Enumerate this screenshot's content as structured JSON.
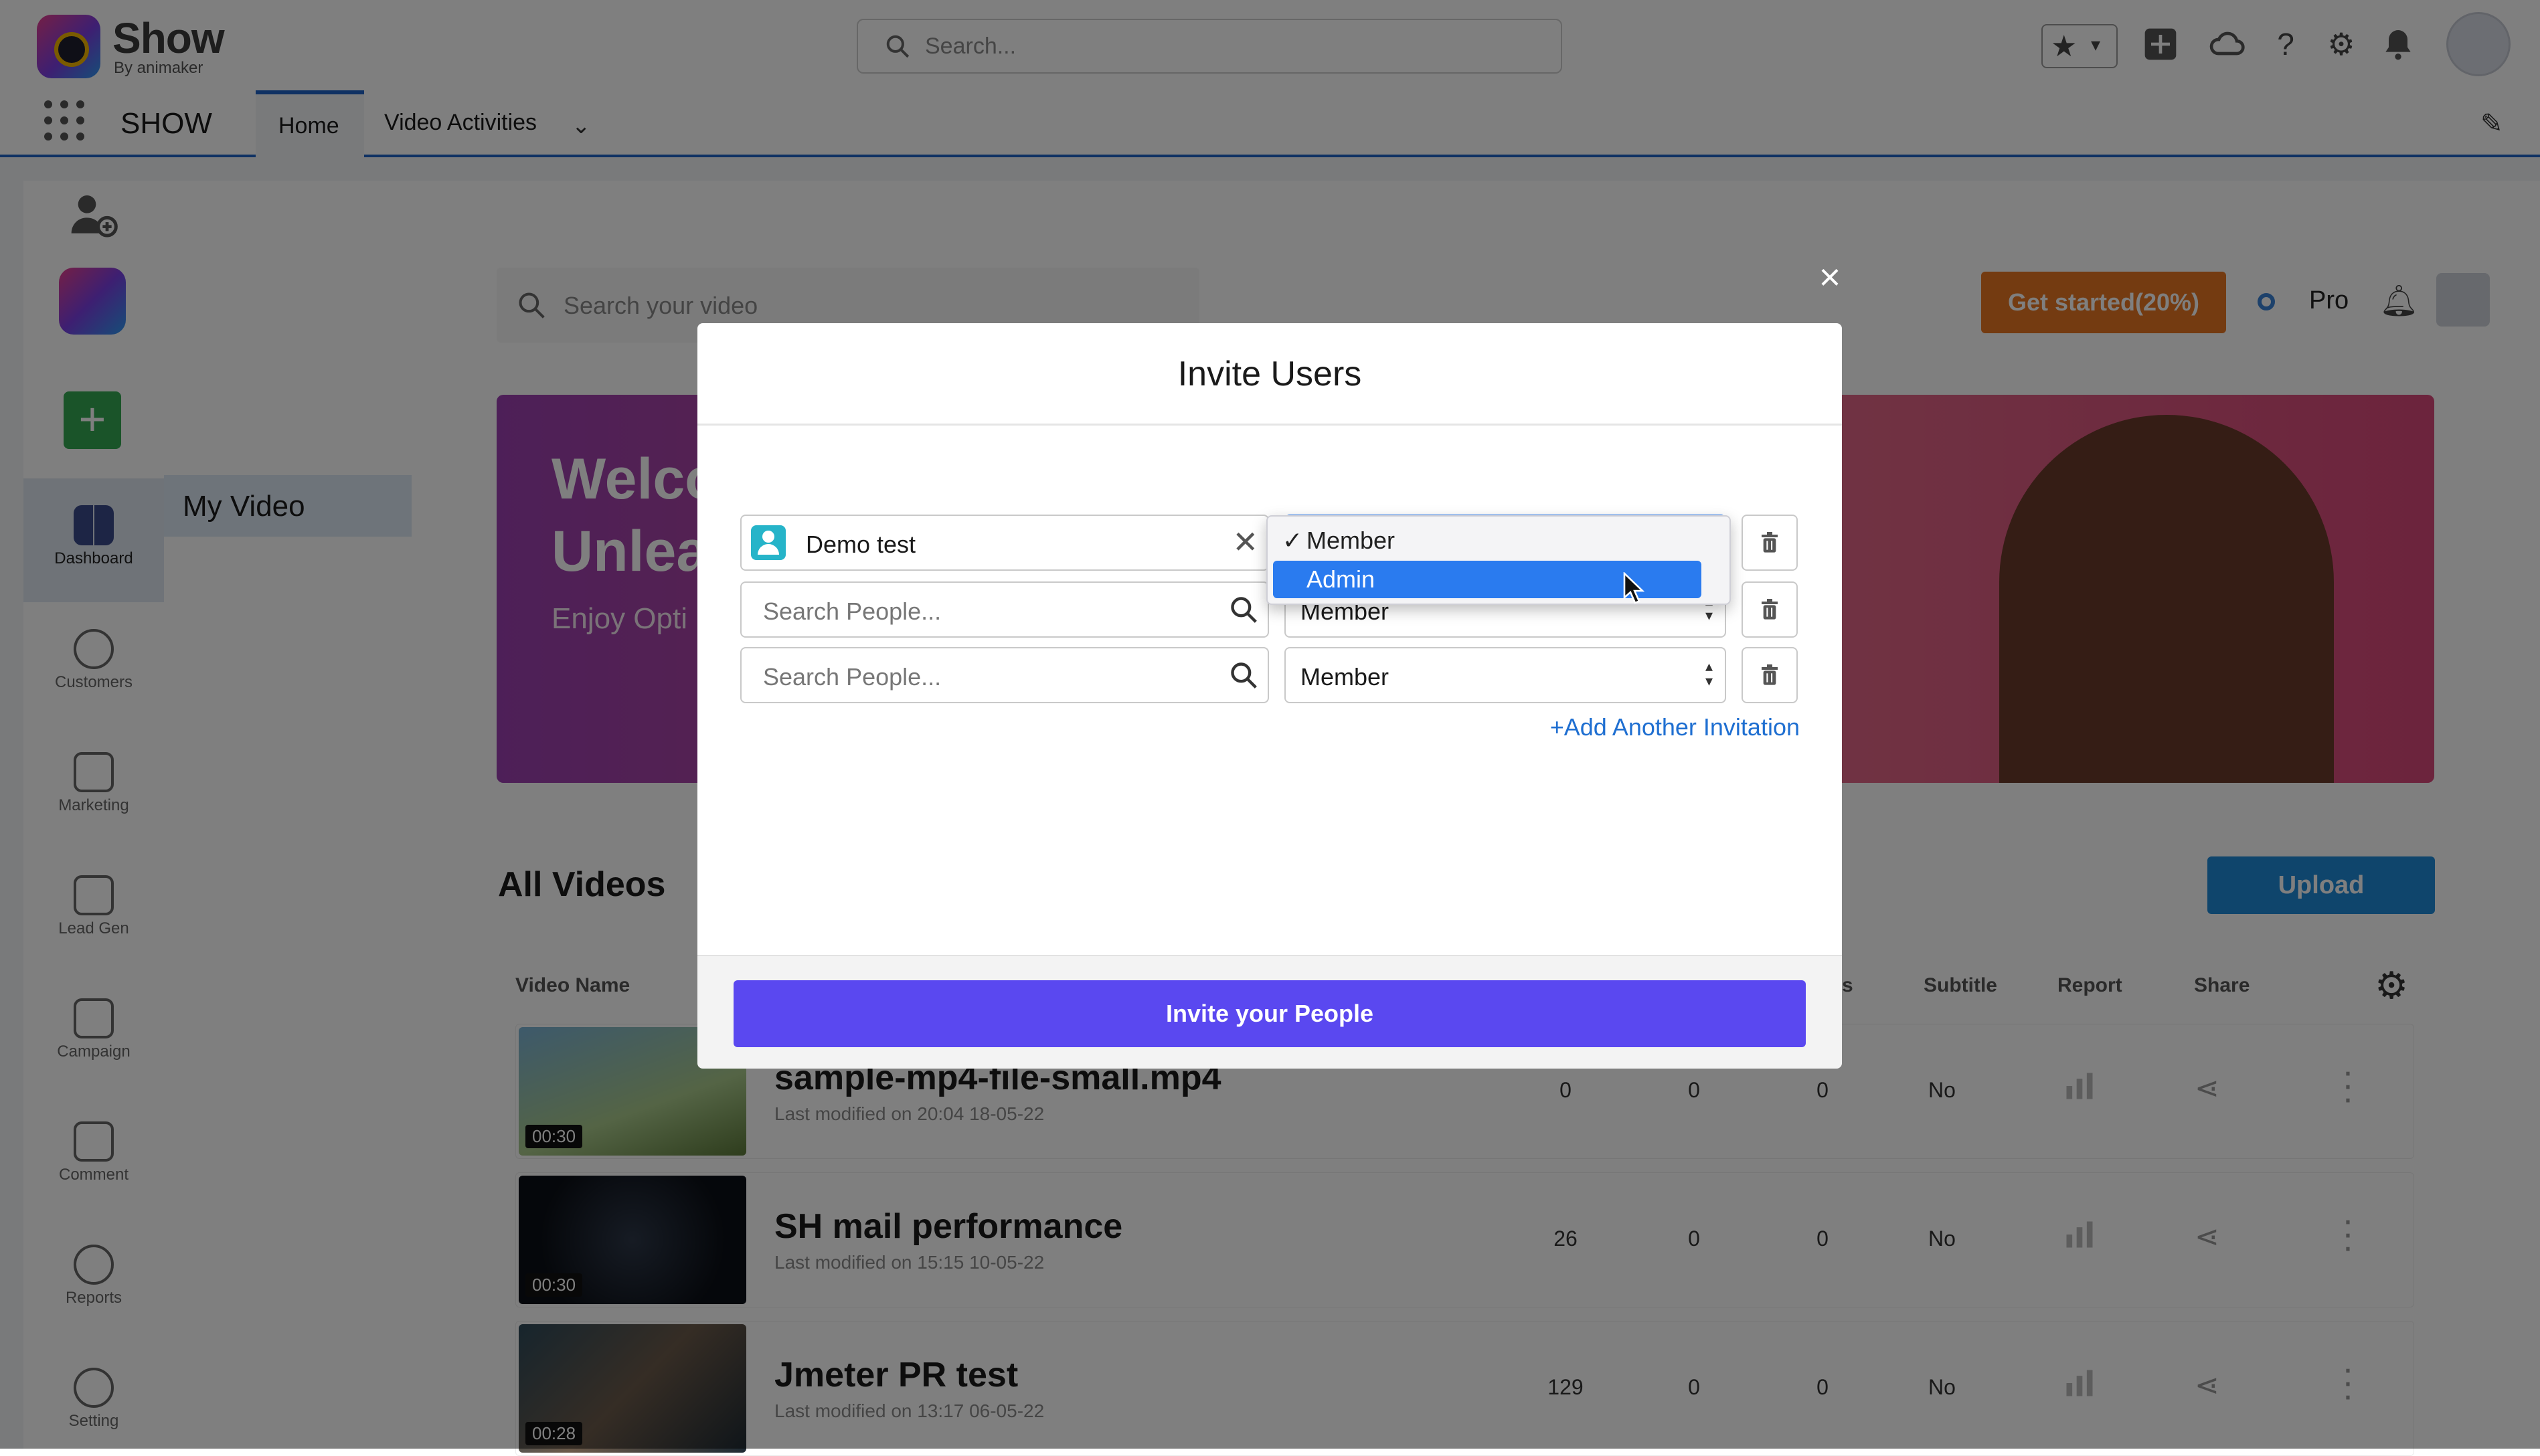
{
  "header": {
    "logo_text": "Show",
    "logo_sub": "By animaker",
    "search_placeholder": "Search...",
    "icons": [
      "star-icon",
      "chevron-down-icon",
      "plus-icon",
      "cloud-icon",
      "help-icon",
      "gear-icon",
      "bell-icon",
      "avatar"
    ]
  },
  "nav": {
    "app_name": "SHOW",
    "tabs": [
      {
        "label": "Home",
        "active": true
      },
      {
        "label": "Video Activities",
        "active": false
      }
    ]
  },
  "left_rail": {
    "items": [
      {
        "label": "Dashboard",
        "icon": "dashboard-icon",
        "active": true
      },
      {
        "label": "Customers",
        "icon": "person-icon"
      },
      {
        "label": "Marketing",
        "icon": "monitor-icon"
      },
      {
        "label": "Lead Gen",
        "icon": "lead-icon"
      },
      {
        "label": "Campaign",
        "icon": "ad-icon"
      },
      {
        "label": "Comment",
        "icon": "comment-icon"
      },
      {
        "label": "Reports",
        "icon": "reports-icon"
      },
      {
        "label": "Setting",
        "icon": "gear-icon"
      }
    ]
  },
  "side_panel": {
    "active_item": "My Video"
  },
  "content": {
    "search_placeholder": "Search your video",
    "get_started": "Get started(20%)",
    "plan": "Pro",
    "banner": {
      "line1": "Welco",
      "line2": "Unleas",
      "line3": "Enjoy Opti"
    },
    "section_title": "All Videos",
    "upload_label": "Upload",
    "columns": [
      "Video Name",
      "s",
      "Subtitle",
      "Report",
      "Share"
    ],
    "videos": [
      {
        "name": "sample-mp4-file-small.mp4",
        "modified": "Last modified on 20:04 18-05-22",
        "duration": "00:30",
        "c1": "0",
        "c2": "0",
        "c3": "0",
        "subtitle": "No"
      },
      {
        "name": "SH mail performance",
        "modified": "Last modified on 15:15 10-05-22",
        "duration": "00:30",
        "c1": "26",
        "c2": "0",
        "c3": "0",
        "subtitle": "No"
      },
      {
        "name": "Jmeter PR test",
        "modified": "Last modified on 13:17 06-05-22",
        "duration": "00:28",
        "c1": "129",
        "c2": "0",
        "c3": "0",
        "subtitle": "No"
      }
    ]
  },
  "modal": {
    "title": "Invite Users",
    "rows": [
      {
        "person": "Demo test",
        "role": "Member"
      },
      {
        "person_placeholder": "Search People...",
        "role": "Member"
      },
      {
        "person_placeholder": "Search People...",
        "role": "Member"
      }
    ],
    "add_another": "+Add Another Invitation",
    "submit": "Invite your People",
    "dropdown": {
      "options": [
        {
          "label": "Member",
          "checked": true
        },
        {
          "label": "Admin",
          "highlighted": true
        }
      ]
    }
  },
  "colors": {
    "accent_blue": "#1f63c7",
    "invite_button": "#5a48f0",
    "get_started": "#e87722",
    "upload": "#1f8ad8",
    "dropdown_highlight": "#2a7bef"
  }
}
